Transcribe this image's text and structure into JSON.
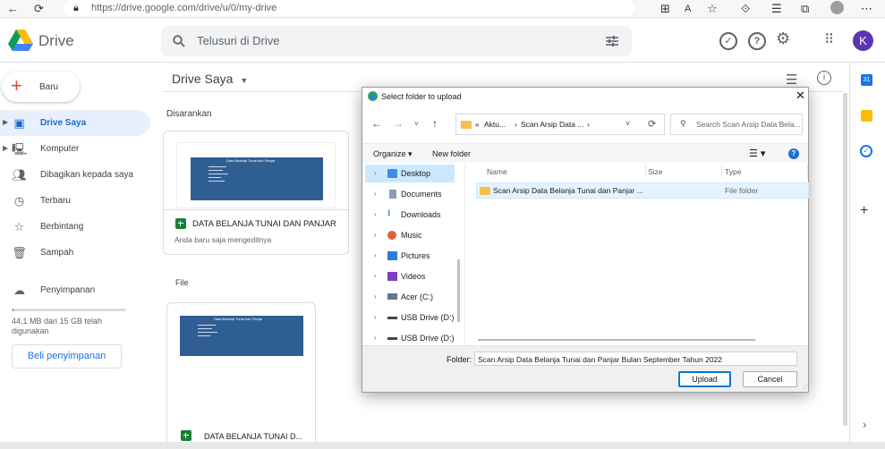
{
  "browser": {
    "url": "https://drive.google.com/drive/u/0/my-drive"
  },
  "header": {
    "logo_text": "Drive",
    "search_placeholder": "Telusuri di Drive",
    "avatar_letter": "K"
  },
  "sidebar": {
    "new_label": "Baru",
    "items": [
      {
        "label": "Drive Saya",
        "icon": "my-drive-icon",
        "active": true
      },
      {
        "label": "Komputer",
        "icon": "computer-icon"
      },
      {
        "label": "Dibagikan kepada saya",
        "icon": "shared-icon"
      },
      {
        "label": "Terbaru",
        "icon": "clock-icon"
      },
      {
        "label": "Berbintang",
        "icon": "star-icon"
      },
      {
        "label": "Sampah",
        "icon": "trash-icon"
      }
    ],
    "storage_label": "Penyimpanan",
    "storage_usage": "44,1 MB dari 15 GB telah digunakan",
    "storage_used_fraction": 0.003,
    "buy_storage_label": "Beli penyimpanan"
  },
  "main": {
    "title": "Drive Saya",
    "suggested_label": "Disarankan",
    "suggested_file": {
      "name": "DATA BELANJA TUNAI DAN PANJAR",
      "subtitle": "Anda baru saja mengeditnya"
    },
    "files_label": "File",
    "file_card": {
      "name": "DATA BELANJA TUNAI D..."
    },
    "thumb_title": "Data Belanja Tunai dan Panjar"
  },
  "dialog": {
    "title": "Select folder to upload",
    "path": [
      "«",
      "Aktu...",
      "›",
      "Scan Arsip Data ...",
      "›"
    ],
    "search_placeholder": "Search Scan Arsip Data Bela...",
    "organize_label": "Organize",
    "new_folder_label": "New folder",
    "help_label": "?",
    "tree": [
      {
        "label": "Desktop",
        "selected": true
      },
      {
        "label": "Documents"
      },
      {
        "label": "Downloads"
      },
      {
        "label": "Music"
      },
      {
        "label": "Pictures"
      },
      {
        "label": "Videos"
      },
      {
        "label": "Acer (C:)"
      },
      {
        "label": "USB Drive (D:)"
      },
      {
        "label": "USB Drive (D:)"
      }
    ],
    "columns": [
      "Name",
      "Size",
      "Type"
    ],
    "rows": [
      {
        "name": "Scan Arsip Data Belanja Tunai dan Panjar ...",
        "size": "",
        "type": "File folder"
      }
    ],
    "folder_label": "Folder:",
    "folder_value": "Scan Arsip Data Belanja Tunai dan Panjar Bulan September Tahun 2022",
    "upload_label": "Upload",
    "cancel_label": "Cancel"
  },
  "colors": {
    "accent": "#1a73e8",
    "active_nav_bg": "#e8f0fe",
    "avatar_bg": "#5e35b1",
    "sheet_green": "#188038",
    "thumb_blue": "#2f5e93"
  }
}
